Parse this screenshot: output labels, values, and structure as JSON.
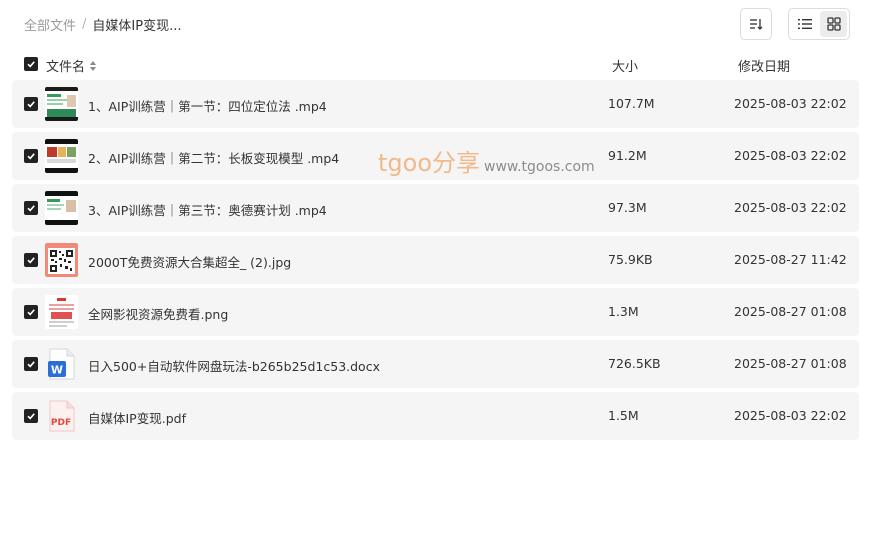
{
  "breadcrumb": {
    "root": "全部文件",
    "separator": "/",
    "current": "自媒体IP变现..."
  },
  "toolbar": {
    "sort_icon": "sort-list-icon",
    "list_view_icon": "list-view-icon",
    "grid_view_icon": "grid-view-icon",
    "active_view": "grid"
  },
  "table": {
    "headers": {
      "name": "文件名",
      "size": "大小",
      "date": "修改日期"
    }
  },
  "files": [
    {
      "name": "1、AIP训练营｜第一节：四位定位法 .mp4",
      "size": "107.7M",
      "date": "2025-08-03 22:02",
      "type": "video"
    },
    {
      "name": "2、AIP训练营｜第二节：长板变现模型 .mp4",
      "size": "91.2M",
      "date": "2025-08-03 22:02",
      "type": "video"
    },
    {
      "name": "3、AIP训练营｜第三节：奥德赛计划 .mp4",
      "size": "97.3M",
      "date": "2025-08-03 22:02",
      "type": "video"
    },
    {
      "name": "2000T免费资源大合集超全_ (2).jpg",
      "size": "75.9KB",
      "date": "2025-08-27 11:42",
      "type": "image-qr"
    },
    {
      "name": "全网影视资源免费看.png",
      "size": "1.3M",
      "date": "2025-08-27 01:08",
      "type": "image-png"
    },
    {
      "name": "日入500+自动软件网盘玩法-b265b25d1c53.docx",
      "size": "726.5KB",
      "date": "2025-08-27 01:08",
      "type": "docx"
    },
    {
      "name": "自媒体IP变现.pdf",
      "size": "1.5M",
      "date": "2025-08-03 22:02",
      "type": "pdf"
    }
  ],
  "watermark": {
    "brand": "tgoo分享",
    "url": "www.tgoos.com"
  },
  "icons": {
    "word_letter": "W",
    "pdf_label": "PDF"
  },
  "colors": {
    "row_bg": "#f5f5f5",
    "checkbox": "#222222",
    "watermark_brand": "#f2b98a",
    "word_blue": "#2b6fd6",
    "pdf_red": "#e8453c"
  }
}
